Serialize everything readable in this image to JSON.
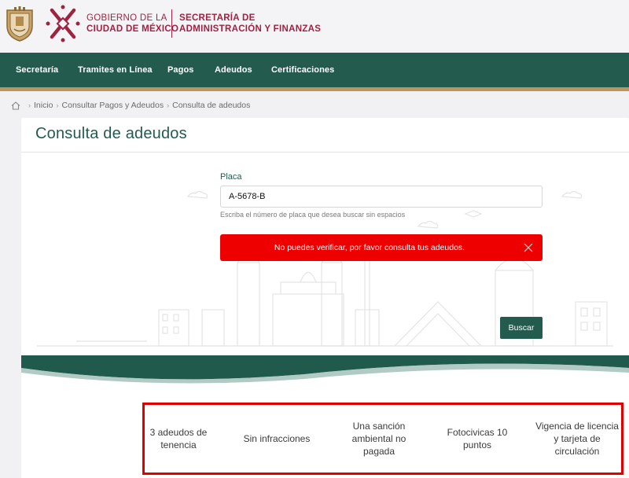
{
  "header": {
    "gov_line1": "GOBIERNO DE LA",
    "gov_line2": "CIUDAD DE MÉXICO",
    "sec_line1": "SECRETARÍA DE",
    "sec_line2": "ADMINISTRACIÓN Y FINANZAS",
    "brand_color": "#9f2241"
  },
  "nav": {
    "items": [
      "Secretaría",
      "Tramites en Línea",
      "Pagos",
      "Adeudos",
      "Certificaciones"
    ],
    "bg_color": "#235b4e",
    "accent_color": "#bc955c"
  },
  "breadcrumb": {
    "home_icon": "home-icon",
    "items": [
      "Inicio",
      "Consultar Pagos y Adeudos",
      "Consulta de adeudos"
    ]
  },
  "form": {
    "title": "Consulta de adeudos",
    "label": "Placa",
    "value": "A-5678-B",
    "help": "Escriba el número de placa que desea buscar sin espacios",
    "alert_text": "No puedes verificar, por favor consulta tus adeudos.",
    "alert_color": "#ee0000",
    "button_label": "Buscar"
  },
  "summary": {
    "items": [
      "3 adeudos de tenencia",
      "Sin infracciones",
      "Una sanción ambiental no pagada",
      "Fotocivicas 10 puntos",
      "Vigencia de licencia y tarjeta de circulación"
    ]
  }
}
